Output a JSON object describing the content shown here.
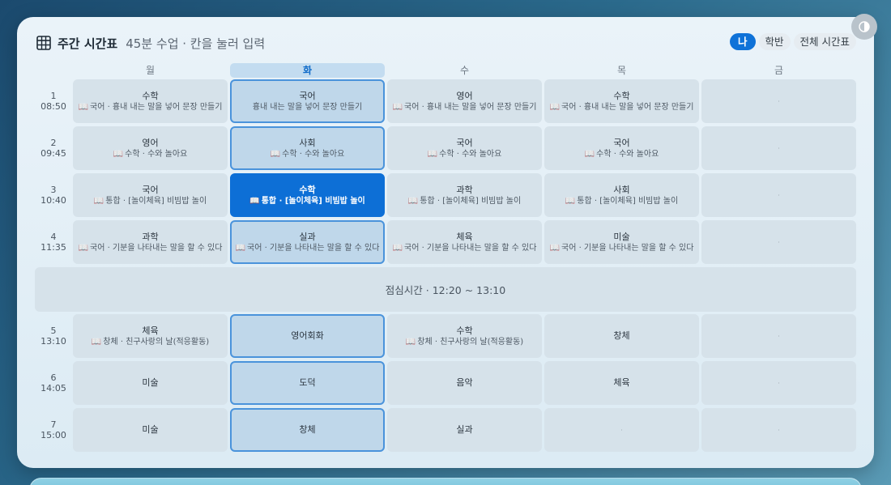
{
  "header": {
    "title": "주간 시간표",
    "subtitle": "45분 수업 · 칸을 눌러 입력",
    "icon": "calendar-grid-icon"
  },
  "view_toggle": [
    {
      "label": "나",
      "active": true
    },
    {
      "label": "학반",
      "active": false
    },
    {
      "label": "전체 시간표",
      "active": false
    }
  ],
  "theme_toggle_icon": "half-circle-icon",
  "days": [
    {
      "label": "월",
      "today": false
    },
    {
      "label": "화",
      "today": true
    },
    {
      "label": "수",
      "today": false
    },
    {
      "label": "목",
      "today": false
    },
    {
      "label": "금",
      "today": false
    }
  ],
  "periods": [
    {
      "num": "1",
      "time": "08:50"
    },
    {
      "num": "2",
      "time": "09:45"
    },
    {
      "num": "3",
      "time": "10:40"
    },
    {
      "num": "4",
      "time": "11:35"
    },
    {
      "num": "5",
      "time": "13:10"
    },
    {
      "num": "6",
      "time": "14:05"
    },
    {
      "num": "7",
      "time": "15:00"
    }
  ],
  "lunch": "점심시간 · 12:20 ~ 13:10",
  "grid": [
    [
      {
        "subject": "수학",
        "note": "국어 · 흉내 내는 말을 넣어 문장 만들기",
        "book": true
      },
      {
        "subject": "국어",
        "note": "흉내 내는 말을 넣어 문장 만들기",
        "book": false
      },
      {
        "subject": "영어",
        "note": "국어 · 흉내 내는 말을 넣어 문장 만들기",
        "book": true
      },
      {
        "subject": "수학",
        "note": "국어 · 흉내 내는 말을 넣어 문장 만들기",
        "book": true
      },
      {
        "subject": "",
        "note": "",
        "empty": true
      }
    ],
    [
      {
        "subject": "영어",
        "note": "수학 · 수와 놀아요",
        "book": true
      },
      {
        "subject": "사회",
        "note": "수학 · 수와 놀아요",
        "book": true
      },
      {
        "subject": "국어",
        "note": "수학 · 수와 놀아요",
        "book": true
      },
      {
        "subject": "국어",
        "note": "수학 · 수와 놀아요",
        "book": true
      },
      {
        "subject": "",
        "note": "",
        "empty": true
      }
    ],
    [
      {
        "subject": "국어",
        "note": "통합 · [놀이체육] 비빔밥 놀이",
        "book": true
      },
      {
        "subject": "수학",
        "note": "통합 · [놀이체육] 비빔밥 놀이",
        "book": true,
        "active": true
      },
      {
        "subject": "과학",
        "note": "통합 · [놀이체육] 비빔밥 놀이",
        "book": true
      },
      {
        "subject": "사회",
        "note": "통합 · [놀이체육] 비빔밥 놀이",
        "book": true
      },
      {
        "subject": "",
        "note": "",
        "empty": true
      }
    ],
    [
      {
        "subject": "과학",
        "note": "국어 · 기분을 나타내는 말을 할 수 있다",
        "book": true
      },
      {
        "subject": "실과",
        "note": "국어 · 기분을 나타내는 말을 할 수 있다",
        "book": true
      },
      {
        "subject": "체육",
        "note": "국어 · 기분을 나타내는 말을 할 수 있다",
        "book": true
      },
      {
        "subject": "미술",
        "note": "국어 · 기분을 나타내는 말을 할 수 있다",
        "book": true
      },
      {
        "subject": "",
        "note": "",
        "empty": true
      }
    ],
    [
      {
        "subject": "체육",
        "note": "창체 · 친구사랑의 날(적응활동)",
        "book": true
      },
      {
        "subject": "영어회화",
        "note": "",
        "book": false
      },
      {
        "subject": "수학",
        "note": "창체 · 친구사랑의 날(적응활동)",
        "book": true
      },
      {
        "subject": "창체",
        "note": "",
        "book": false
      },
      {
        "subject": "",
        "note": "",
        "empty": true
      }
    ],
    [
      {
        "subject": "미술",
        "note": "",
        "book": false
      },
      {
        "subject": "도덕",
        "note": "",
        "book": false
      },
      {
        "subject": "음악",
        "note": "",
        "book": false
      },
      {
        "subject": "체육",
        "note": "",
        "book": false
      },
      {
        "subject": "",
        "note": "",
        "empty": true
      }
    ],
    [
      {
        "subject": "미술",
        "note": "",
        "book": false
      },
      {
        "subject": "창체",
        "note": "",
        "book": false
      },
      {
        "subject": "실과",
        "note": "",
        "book": false
      },
      {
        "subject": "",
        "note": "",
        "empty": true
      },
      {
        "subject": "",
        "note": "",
        "empty": true
      }
    ]
  ],
  "empty_marker": "·",
  "colors": {
    "accent": "#0f72d8",
    "today_border": "#4a93db",
    "cell_bg": "#d6e2ea"
  }
}
